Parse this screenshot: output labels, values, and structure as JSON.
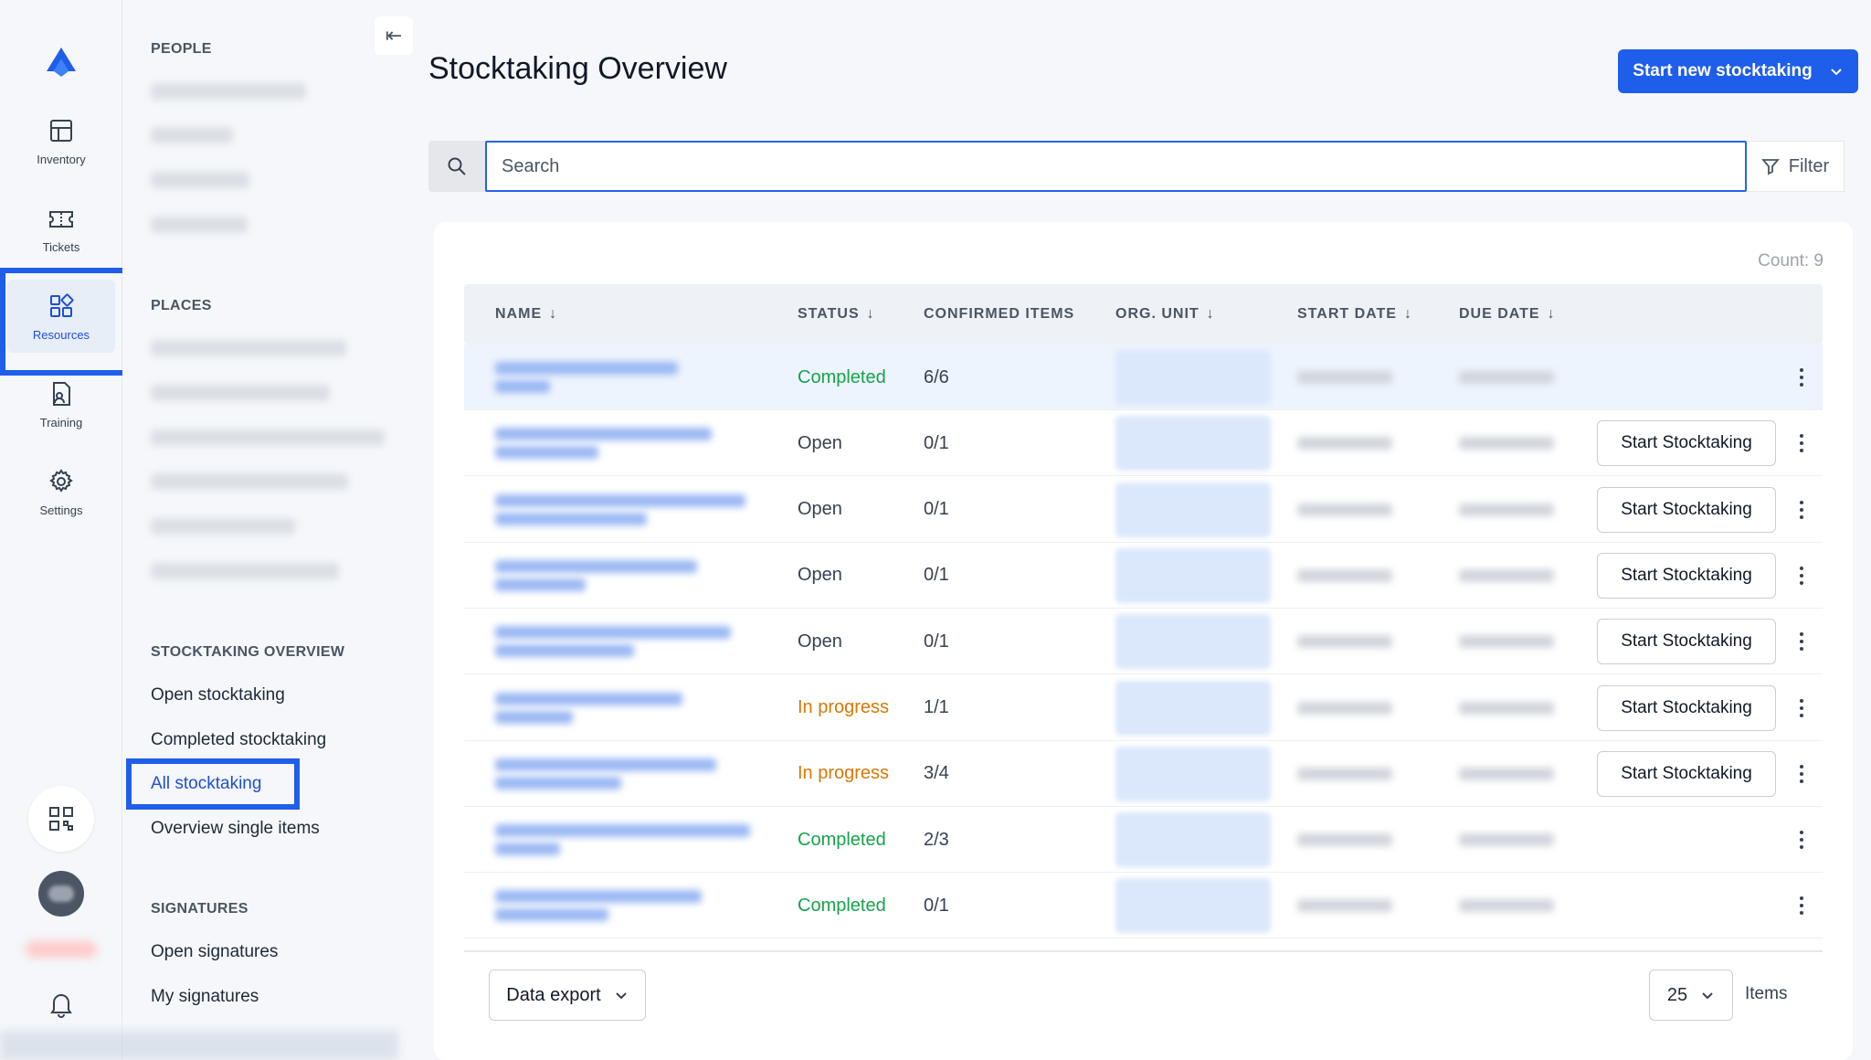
{
  "rail": {
    "items": [
      {
        "label": "Inventory",
        "icon": "table-grid-icon"
      },
      {
        "label": "Tickets",
        "icon": "ticket-icon"
      },
      {
        "label": "Resources",
        "icon": "resources-icon"
      },
      {
        "label": "Training",
        "icon": "training-icon"
      },
      {
        "label": "Settings",
        "icon": "gear-icon"
      }
    ],
    "active_index": 2
  },
  "sidebar": {
    "sections": {
      "people": "PEOPLE",
      "places": "PLACES",
      "stocktaking": "STOCKTAKING OVERVIEW",
      "signatures": "SIGNATURES"
    },
    "stocktaking_links": [
      "Open stocktaking",
      "Completed stocktaking",
      "All stocktaking",
      "Overview single items"
    ],
    "signature_links": [
      "Open signatures",
      "My signatures"
    ],
    "active_link": "All stocktaking"
  },
  "header": {
    "title": "Stocktaking Overview",
    "start_new_label": "Start new stocktaking"
  },
  "search": {
    "placeholder": "Search",
    "filter_label": "Filter"
  },
  "table": {
    "count_label": "Count: 9",
    "columns": [
      "NAME",
      "STATUS",
      "CONFIRMED ITEMS",
      "ORG. UNIT",
      "START DATE",
      "DUE DATE"
    ],
    "start_button_label": "Start Stocktaking",
    "rows": [
      {
        "status": "Completed",
        "confirmed": "6/6",
        "actionable": false
      },
      {
        "status": "Open",
        "confirmed": "0/1",
        "actionable": true
      },
      {
        "status": "Open",
        "confirmed": "0/1",
        "actionable": true
      },
      {
        "status": "Open",
        "confirmed": "0/1",
        "actionable": true
      },
      {
        "status": "Open",
        "confirmed": "0/1",
        "actionable": true
      },
      {
        "status": "In progress",
        "confirmed": "1/1",
        "actionable": true
      },
      {
        "status": "In progress",
        "confirmed": "3/4",
        "actionable": true
      },
      {
        "status": "Completed",
        "confirmed": "2/3",
        "actionable": false
      },
      {
        "status": "Completed",
        "confirmed": "0/1",
        "actionable": false
      }
    ]
  },
  "footer": {
    "export_label": "Data export",
    "page_size": "25",
    "items_label": "Items"
  },
  "colors": {
    "accent": "#1f5eea",
    "completed": "#16a34a",
    "in_progress": "#d97706"
  }
}
